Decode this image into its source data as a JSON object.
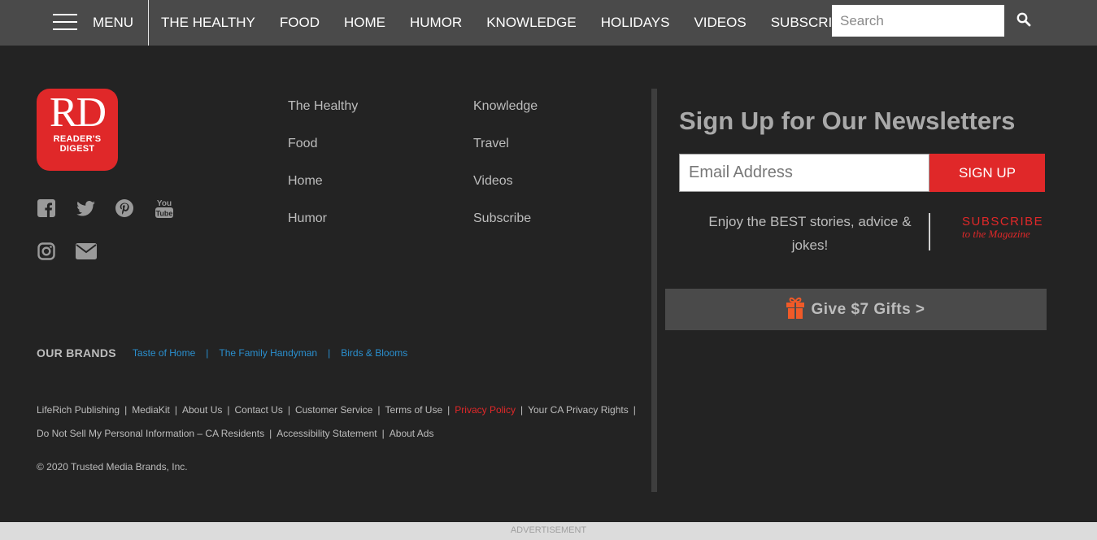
{
  "nav": {
    "menu_label": "MENU",
    "links": [
      "THE HEALTHY",
      "FOOD",
      "HOME",
      "HUMOR",
      "KNOWLEDGE",
      "HOLIDAYS",
      "VIDEOS",
      "SUBSCRIBE"
    ],
    "search_placeholder": "Search"
  },
  "logo": {
    "mark": "RD",
    "line1": "READER'S",
    "line2": "DIGEST"
  },
  "social_icons": [
    "facebook-icon",
    "twitter-icon",
    "pinterest-icon",
    "youtube-icon",
    "instagram-icon",
    "email-icon"
  ],
  "columns": {
    "left": [
      "The Healthy",
      "Food",
      "Home",
      "Humor"
    ],
    "right": [
      "Knowledge",
      "Travel",
      "Videos",
      "Subscribe"
    ]
  },
  "brands": {
    "label": "OUR BRANDS",
    "items": [
      "Taste of Home",
      "The Family Handyman",
      "Birds & Blooms"
    ]
  },
  "legal": {
    "row1": [
      "LifeRich Publishing",
      "MediaKit",
      "About Us",
      "Contact Us",
      "Customer Service",
      "Terms of Use",
      "Privacy Policy",
      "Your CA Privacy Rights"
    ],
    "row2": [
      "Do Not Sell My Personal Information – CA Residents",
      "Accessibility Statement",
      "About Ads"
    ],
    "copyright": "© 2020 Trusted Media Brands, Inc."
  },
  "newsletter": {
    "title": "Sign Up for Our Newsletters",
    "email_placeholder": "Email Address",
    "signup_label": "SIGN UP",
    "enjoy_text": "Enjoy the BEST stories, advice & jokes!",
    "subscribe_line1": "SUBSCRIBE",
    "subscribe_line2": "to the Magazine",
    "gifts_label": "Give $7 Gifts >"
  },
  "ad_label": "ADVERTISEMENT",
  "colors": {
    "accent": "#e02829",
    "brand_link": "#2a8fce",
    "nav_bg": "#4a4a4a",
    "page_bg": "#232323"
  }
}
